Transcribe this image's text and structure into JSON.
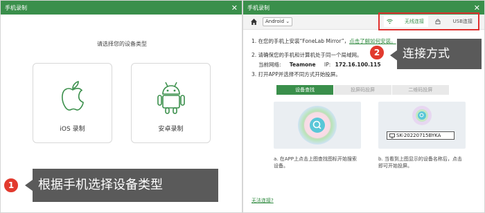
{
  "left_window": {
    "title": "手机录制",
    "prompt": "请选择您的设备类型",
    "ios_label": "iOS 录制",
    "android_label": "安卓录制"
  },
  "right_window": {
    "title": "手机录制",
    "os_select": "Android ⌄",
    "connection_tabs": {
      "wifi": "无线连接",
      "usb": "USB连接"
    },
    "steps": {
      "step1_text": "1. 在您的手机上安装“FoneLab Mirror”，",
      "step1_link": "点击了解如何安装。",
      "step2_text": "2. 请确保您的手机和计算机处于同一个局域网。",
      "network_label": "当前网络:",
      "network_name": "Teamone",
      "ip_label": "IP:",
      "ip_value": "172.16.100.115",
      "step3_text": "3. 打开APP并选择不同方式开始投屏。"
    },
    "segment_tabs": [
      "设备查找",
      "投屏码投屏",
      "二维码投屏"
    ],
    "device_id": "SK-20220715BYKA",
    "desc_left": "a. 在APP上点击上图查找图标开始搜索设备。",
    "desc_right": "b. 当看到上图显示的设备名称后，点击即可开始投屏。",
    "help_link": "无法连接?"
  },
  "callouts": {
    "one": {
      "number": "1",
      "text": "根据手机选择设备类型"
    },
    "two": {
      "number": "2",
      "text": "连接方式"
    }
  },
  "colors": {
    "accent": "#3a8f4b",
    "highlight": "#e0302e",
    "callout_bg": "#5a5a5a",
    "badge": "#e23a2e"
  }
}
